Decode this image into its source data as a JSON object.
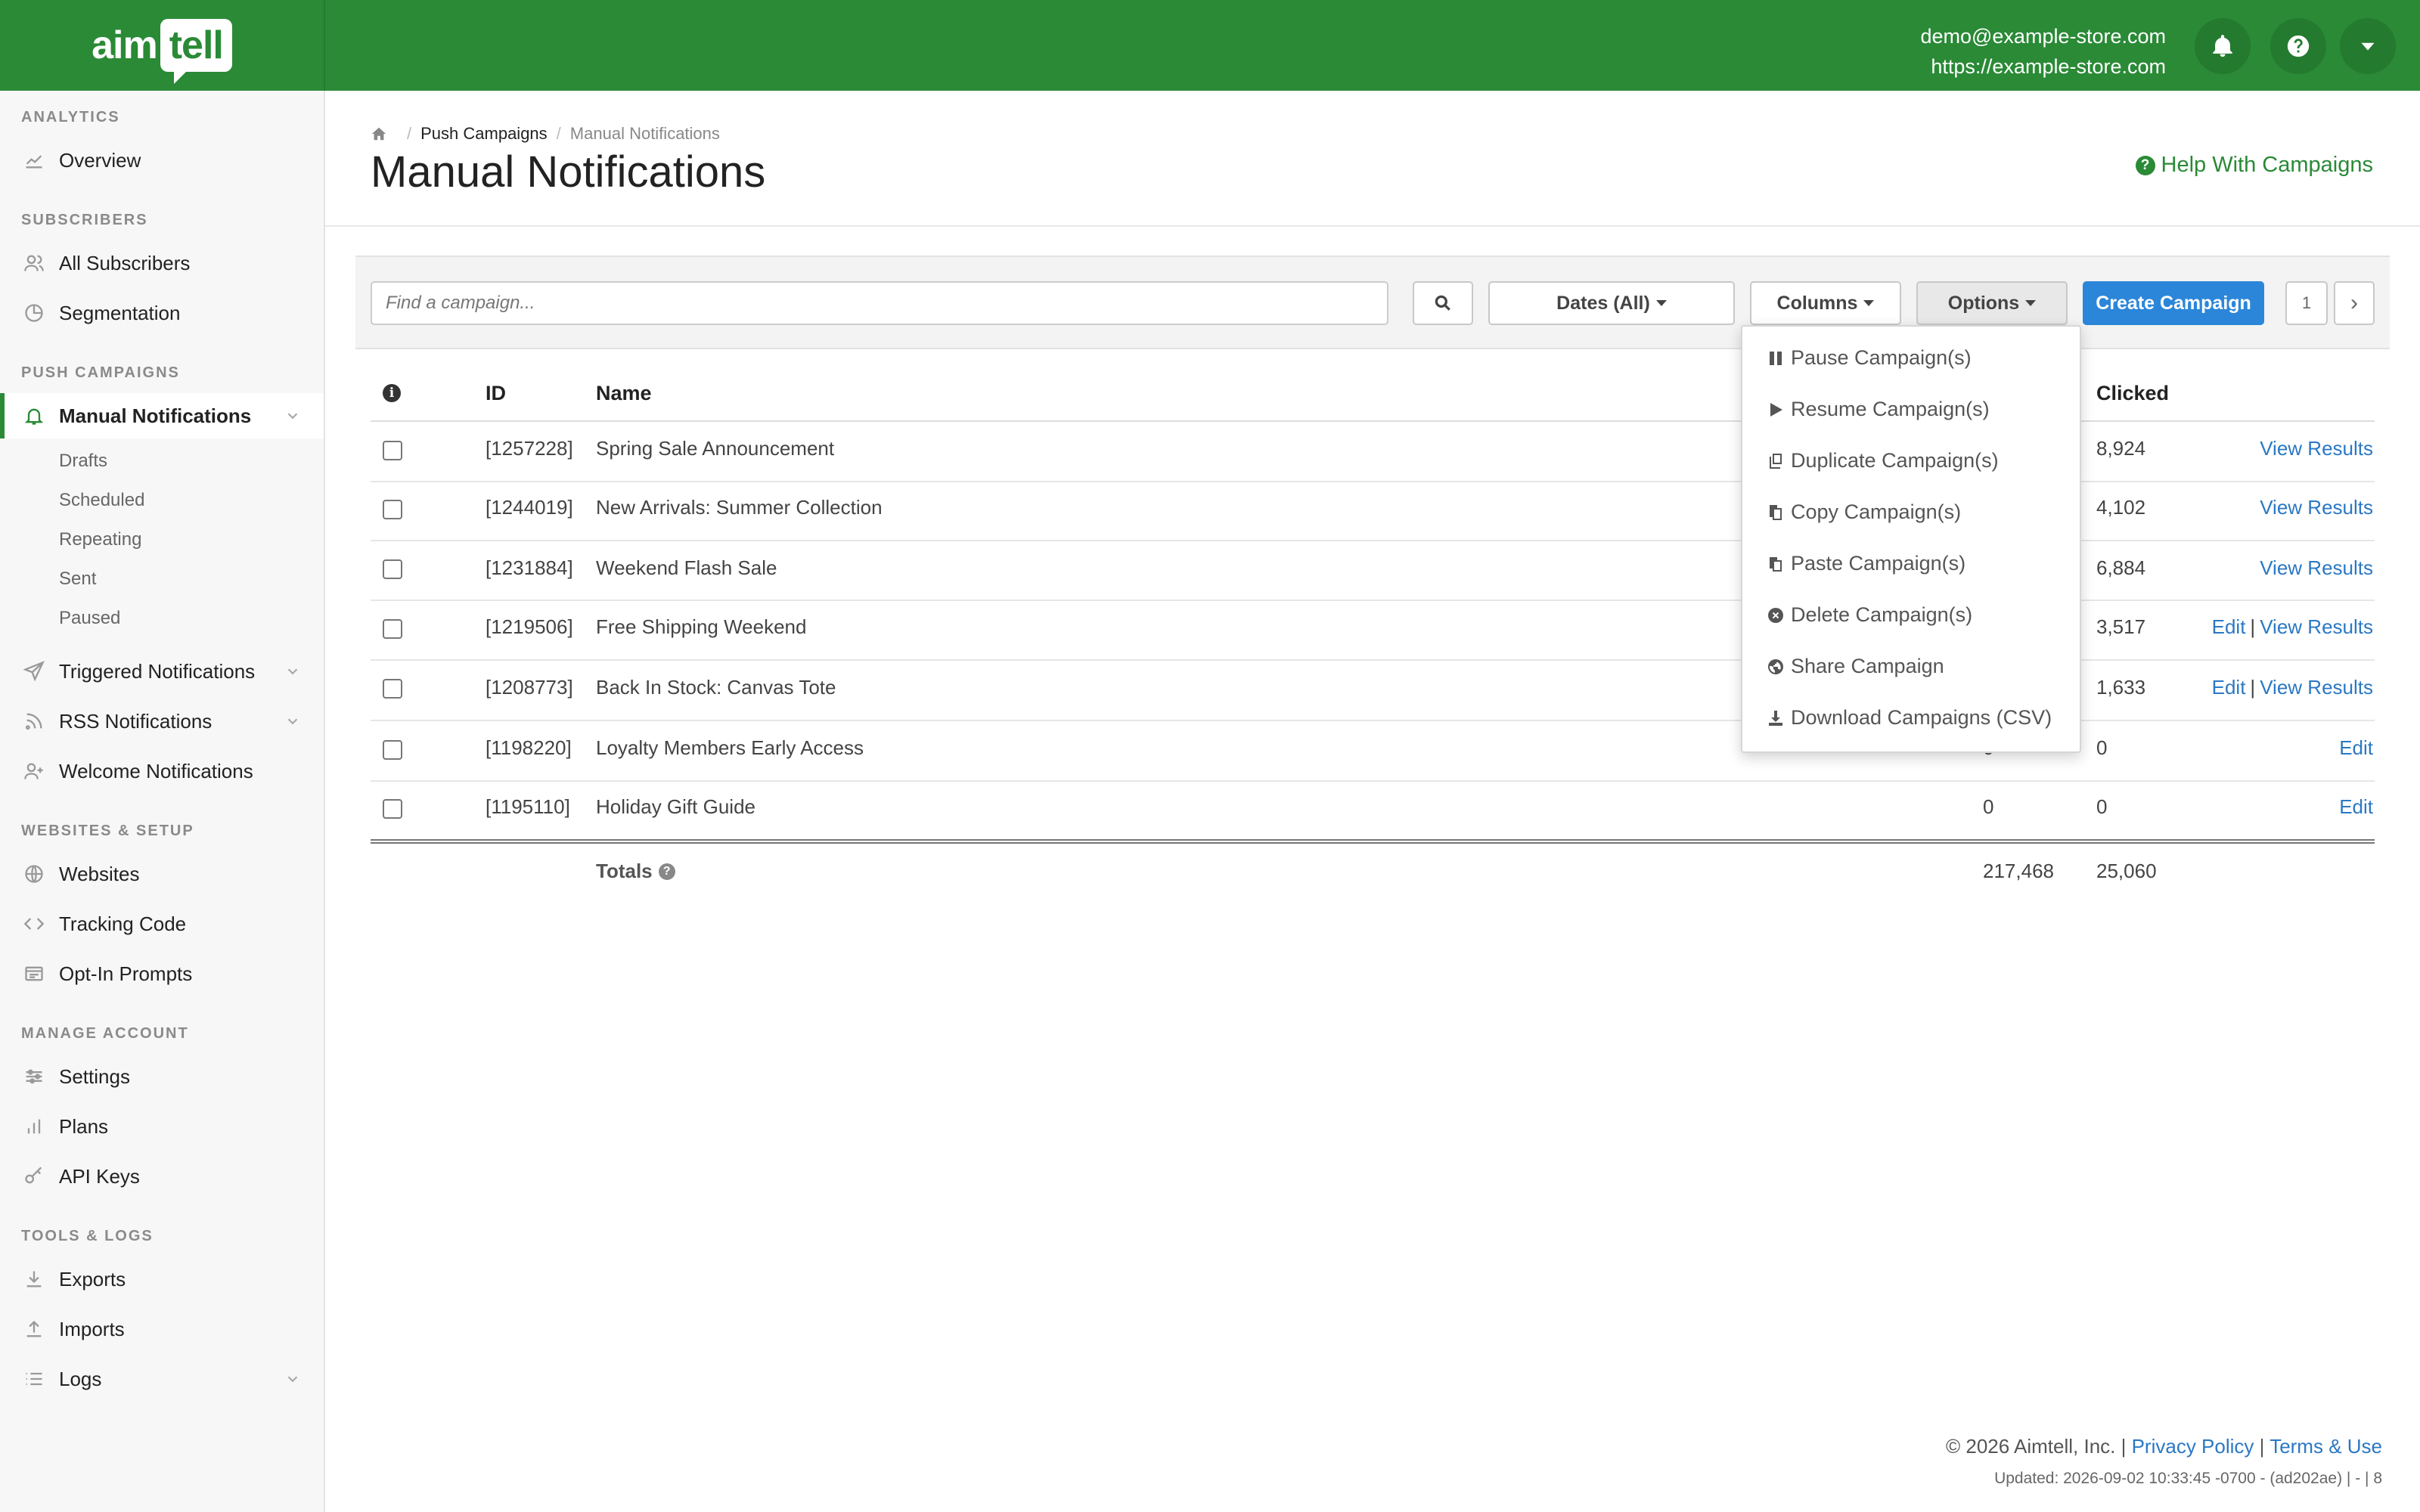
{
  "brand": {
    "logo_text_a": "aim",
    "logo_text_b": "tell"
  },
  "header": {
    "email": "demo@example-store.com",
    "site": "https://example-store.com"
  },
  "sidebar": {
    "sections": [
      {
        "title": "ANALYTICS"
      },
      {
        "title": "SUBSCRIBERS"
      },
      {
        "title": "PUSH CAMPAIGNS"
      },
      {
        "title": "WEBSITES & SETUP"
      },
      {
        "title": "MANAGE ACCOUNT"
      },
      {
        "title": "TOOLS & LOGS"
      }
    ],
    "items": {
      "overview": "Overview",
      "all_subscribers": "All Subscribers",
      "segmentation": "Segmentation",
      "manual_notifications": "Manual Notifications",
      "drafts": "Drafts",
      "scheduled": "Scheduled",
      "repeating": "Repeating",
      "sent": "Sent",
      "paused": "Paused",
      "triggered_notifications": "Triggered Notifications",
      "rss_notifications": "RSS Notifications",
      "welcome_notifications": "Welcome Notifications",
      "websites": "Websites",
      "tracking_code": "Tracking Code",
      "optin_prompts": "Opt-In Prompts",
      "settings": "Settings",
      "plans": "Plans",
      "api_keys": "API Keys",
      "exports": "Exports",
      "imports": "Imports",
      "logs": "Logs"
    }
  },
  "breadcrumb": {
    "parent": "Push Campaigns",
    "current": "Manual Notifications",
    "sep": "/"
  },
  "page": {
    "title": "Manual Notifications",
    "help": "Help With Campaigns"
  },
  "toolbar": {
    "search_placeholder": "Find a campaign...",
    "dates": "Dates (All)",
    "columns": "Columns",
    "options": "Options",
    "create": "Create Campaign",
    "page_number": "1",
    "next": "›"
  },
  "table": {
    "headers": {
      "id": "ID",
      "name": "Name",
      "clicked": "Clicked"
    },
    "rows": [
      {
        "id": "[1257228]",
        "name": "Spring Sale Announcement",
        "clicked": "8,924",
        "edit": "",
        "view": "View Results"
      },
      {
        "id": "[1244019]",
        "name": "New Arrivals: Summer Collection",
        "clicked": "4,102",
        "edit": "",
        "view": "View Results"
      },
      {
        "id": "[1231884]",
        "name": "Weekend Flash Sale",
        "clicked": "6,884",
        "edit": "",
        "view": "View Results"
      },
      {
        "id": "[1219506]",
        "name": "Free Shipping Weekend",
        "clicked": "3,517",
        "edit": "Edit",
        "view": "View Results"
      },
      {
        "id": "[1208773]",
        "name": "Back In Stock: Canvas Tote",
        "clicked": "1,633",
        "edit": "Edit",
        "view": "View Results"
      },
      {
        "id": "[1198220]",
        "name": "Loyalty Members Early Access",
        "delivered": "0",
        "clicked": "0",
        "edit": "Edit",
        "view": ""
      },
      {
        "id": "[1195110]",
        "name": "Holiday Gift Guide",
        "delivered": "0",
        "clicked": "0",
        "edit": "Edit",
        "view": ""
      }
    ],
    "totals": {
      "label": "Totals",
      "delivered": "217,468",
      "clicked": "25,060"
    }
  },
  "options_menu": [
    {
      "label": "Pause Campaign(s)",
      "icon": "pause-icon"
    },
    {
      "label": "Resume Campaign(s)",
      "icon": "play-icon"
    },
    {
      "label": "Duplicate Campaign(s)",
      "icon": "duplicate-icon"
    },
    {
      "label": "Copy Campaign(s)",
      "icon": "copy-icon"
    },
    {
      "label": "Paste Campaign(s)",
      "icon": "paste-icon"
    },
    {
      "label": "Delete Campaign(s)",
      "icon": "delete-icon"
    },
    {
      "label": "Share Campaign",
      "icon": "globe-icon"
    },
    {
      "label": "Download Campaigns (CSV)",
      "icon": "download-icon"
    }
  ],
  "footer": {
    "copyright": "© 2026 Aimtell, Inc. |",
    "privacy": "Privacy Policy",
    "divider": "|",
    "terms": "Terms & Use",
    "updated": "Updated: 2026-09-02 10:33:45 -0700 - (ad202ae) | - | 8"
  },
  "colors": {
    "brand_green": "#2a8a36",
    "primary_blue": "#2b86d9",
    "link_blue": "#2b78c4"
  }
}
